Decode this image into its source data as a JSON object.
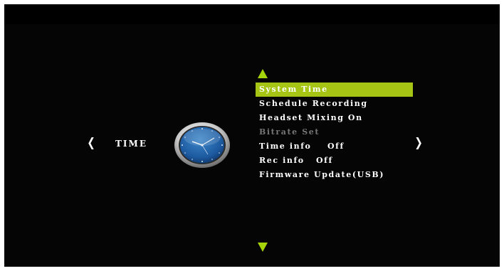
{
  "category": {
    "label": "TIME",
    "prev_arrow": "❮",
    "next_arrow": "❯"
  },
  "icons": {
    "category_icon": "clock-icon",
    "menu_up": "triangle-up-icon",
    "menu_down": "triangle-down-icon"
  },
  "colors": {
    "background": "#000000",
    "accent": "#a6c414",
    "text": "#ffffff",
    "disabled_text": "#777777"
  },
  "menu": {
    "items": [
      {
        "label": "System Time",
        "value": "",
        "state": "selected"
      },
      {
        "label": "Schedule Recording",
        "value": "",
        "state": "normal"
      },
      {
        "label": "Headset Mixing On",
        "value": "",
        "state": "normal"
      },
      {
        "label": "Bitrate Set",
        "value": "",
        "state": "disabled"
      },
      {
        "label": "Time info",
        "value": "Off",
        "state": "normal"
      },
      {
        "label": "Rec info",
        "value": "Off",
        "state": "normal"
      },
      {
        "label": "Firmware Update(USB)",
        "value": "",
        "state": "normal"
      }
    ]
  }
}
